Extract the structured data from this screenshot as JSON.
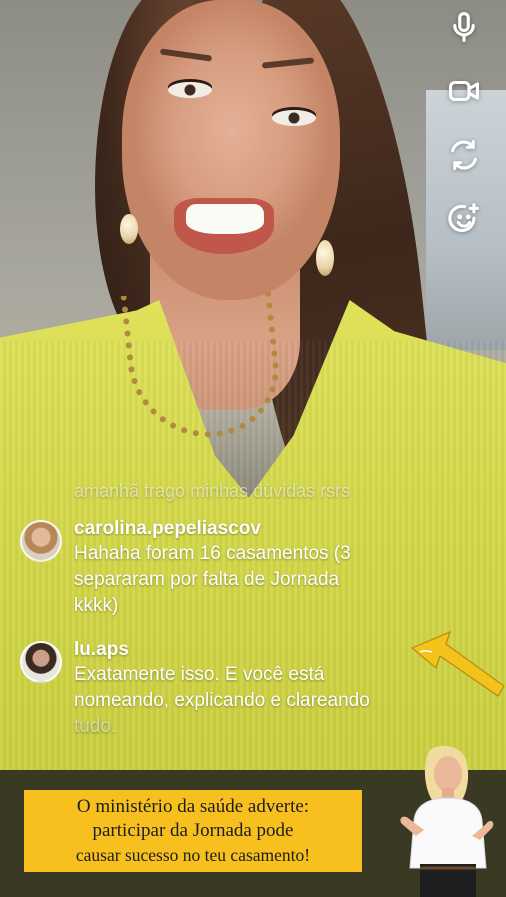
{
  "live_controls": {
    "mic_icon": "microphone-icon",
    "camera_icon": "video-camera-icon",
    "flip_icon": "flip-camera-icon",
    "effects_icon": "face-effects-icon"
  },
  "comments": {
    "faded_previous": "amanhã trago minhas dúvidas rsrs",
    "items": [
      {
        "username": "carolina.pepeliascov",
        "lines": [
          "Hahaha foram 16 casamentos (3",
          "separaram por falta de Jornada",
          "kkkk)"
        ]
      },
      {
        "username": "lu.aps",
        "lines": [
          "Exatamente isso. E você está",
          "nomeando, explicando e clareando",
          "tudo."
        ]
      }
    ]
  },
  "banner": {
    "line1": "O ministério da saúde adverte:",
    "line2": "participar da Jornada pode",
    "line3": "causar sucesso no teu casamento!"
  },
  "colors": {
    "banner_bg": "#3a3a24",
    "banner_box": "#f7c01f",
    "arrow": "#f3c31c"
  }
}
